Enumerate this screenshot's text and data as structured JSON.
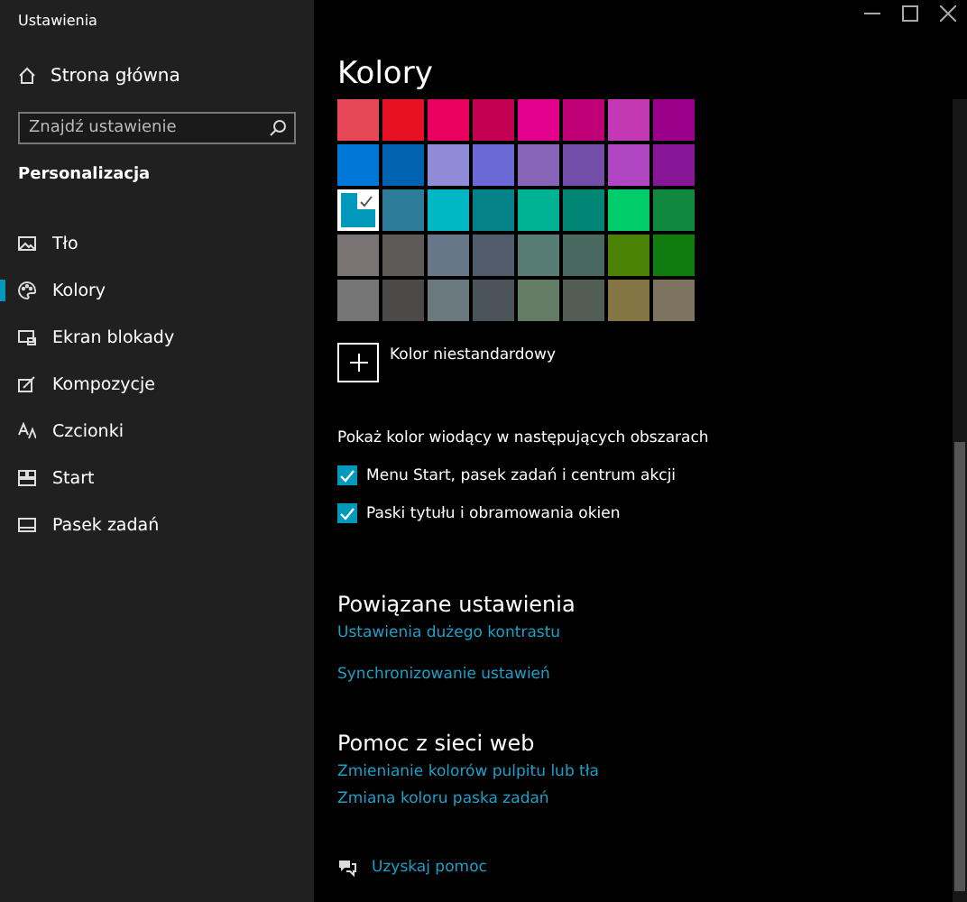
{
  "window": {
    "title": "Ustawienia"
  },
  "sidebar": {
    "home": "Strona główna",
    "search": {
      "placeholder": "Znajdź ustawienie"
    },
    "section": "Personalizacja",
    "items": [
      {
        "label": "Tło",
        "selected": false
      },
      {
        "label": "Kolory",
        "selected": true
      },
      {
        "label": "Ekran blokady",
        "selected": false
      },
      {
        "label": "Kompozycje",
        "selected": false
      },
      {
        "label": "Czcionki",
        "selected": false
      },
      {
        "label": "Start",
        "selected": false
      },
      {
        "label": "Pasek zadań",
        "selected": false
      }
    ]
  },
  "main": {
    "title": "Kolory",
    "swatches": [
      {
        "color": "#e74856",
        "selected": false
      },
      {
        "color": "#e81123",
        "selected": false
      },
      {
        "color": "#ea005e",
        "selected": false
      },
      {
        "color": "#c30052",
        "selected": false
      },
      {
        "color": "#e3008c",
        "selected": false
      },
      {
        "color": "#bf0077",
        "selected": false
      },
      {
        "color": "#c239b3",
        "selected": false
      },
      {
        "color": "#9a0089",
        "selected": false
      },
      {
        "color": "#0078d7",
        "selected": false
      },
      {
        "color": "#0063b1",
        "selected": false
      },
      {
        "color": "#8e8cd8",
        "selected": false
      },
      {
        "color": "#6b69d6",
        "selected": false
      },
      {
        "color": "#8764b8",
        "selected": false
      },
      {
        "color": "#744da9",
        "selected": false
      },
      {
        "color": "#b146c2",
        "selected": false
      },
      {
        "color": "#881798",
        "selected": false
      },
      {
        "color": "#0099bc",
        "selected": true
      },
      {
        "color": "#2d7d9a",
        "selected": false
      },
      {
        "color": "#00b7c3",
        "selected": false
      },
      {
        "color": "#038387",
        "selected": false
      },
      {
        "color": "#00b294",
        "selected": false
      },
      {
        "color": "#018574",
        "selected": false
      },
      {
        "color": "#00cc6a",
        "selected": false
      },
      {
        "color": "#10893e",
        "selected": false
      },
      {
        "color": "#7a7574",
        "selected": false
      },
      {
        "color": "#5d5a58",
        "selected": false
      },
      {
        "color": "#68768a",
        "selected": false
      },
      {
        "color": "#515c6b",
        "selected": false
      },
      {
        "color": "#567c73",
        "selected": false
      },
      {
        "color": "#486860",
        "selected": false
      },
      {
        "color": "#498205",
        "selected": false
      },
      {
        "color": "#107c10",
        "selected": false
      },
      {
        "color": "#767676",
        "selected": false
      },
      {
        "color": "#4c4a48",
        "selected": false
      },
      {
        "color": "#69797e",
        "selected": false
      },
      {
        "color": "#4a5459",
        "selected": false
      },
      {
        "color": "#647c64",
        "selected": false
      },
      {
        "color": "#525e54",
        "selected": false
      },
      {
        "color": "#847545",
        "selected": false
      },
      {
        "color": "#7e735f",
        "selected": false
      }
    ],
    "custom_color": "Kolor niestandardowy",
    "show_accent_label": "Pokaż kolor wiodący w następujących obszarach",
    "checkboxes": [
      {
        "label": "Menu Start, pasek zadań i centrum akcji",
        "checked": true
      },
      {
        "label": "Paski tytułu i obramowania okien",
        "checked": true
      }
    ],
    "related": {
      "title": "Powiązane ustawienia",
      "links": [
        "Ustawienia dużego kontrastu",
        "Synchronizowanie ustawień"
      ]
    },
    "web_help": {
      "title": "Pomoc z sieci web",
      "links": [
        "Zmienianie kolorów pulpitu lub tła",
        "Zmiana koloru paska zadań"
      ]
    },
    "get_help": "Uzyskaj pomoc"
  }
}
